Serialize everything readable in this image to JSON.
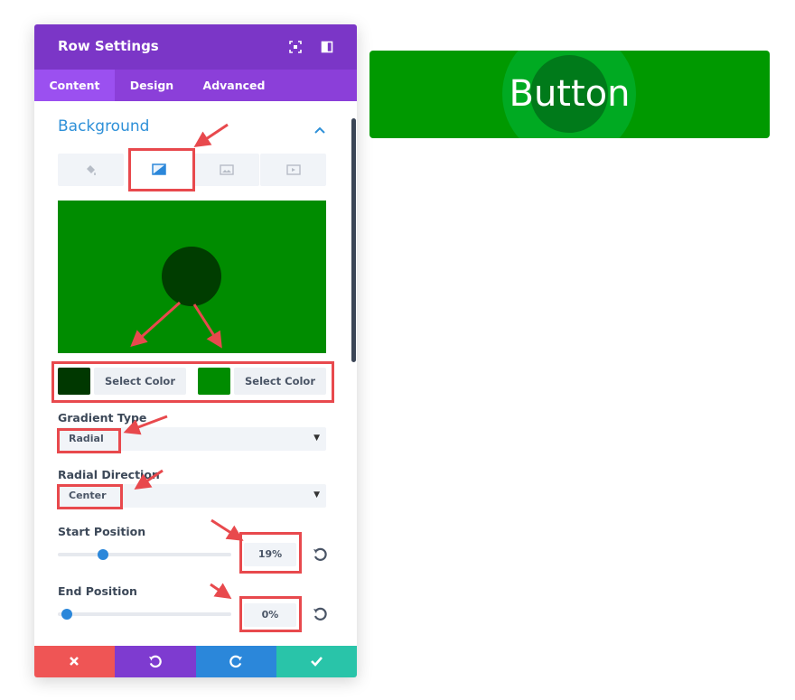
{
  "panel": {
    "title": "Row Settings",
    "tabs": [
      {
        "label": "Content",
        "active": true
      },
      {
        "label": "Design",
        "active": false
      },
      {
        "label": "Advanced",
        "active": false
      }
    ],
    "section_title": "Background",
    "background_tabs": [
      "paint-bucket-icon",
      "gradient-icon",
      "image-icon",
      "video-icon"
    ],
    "active_background_tab": "gradient",
    "colors": {
      "first_swatch": "#003800",
      "second_swatch": "#008c00",
      "select_color_label_1": "Select Color",
      "select_color_label_2": "Select Color",
      "preview_background": "#008c00",
      "preview_circle": "#003d00"
    },
    "gradient_type": {
      "label": "Gradient Type",
      "value": "Radial"
    },
    "radial_direction": {
      "label": "Radial Direction",
      "value": "Center"
    },
    "start_position": {
      "label": "Start Position",
      "value": "19%",
      "fraction": 0.19
    },
    "end_position": {
      "label": "End Position",
      "value": "0%",
      "fraction": 0.0
    },
    "footer": {
      "cancel_color": "#ef5555",
      "undo_color": "#7e3bd0",
      "redo_color": "#2b87da",
      "save_color": "#29c4a9"
    }
  },
  "preview_button": {
    "label": "Button",
    "background": "#009900",
    "outer_ring": "#00aa22",
    "inner_circle": "#007a1a"
  },
  "annotation_color": "#e8494d"
}
